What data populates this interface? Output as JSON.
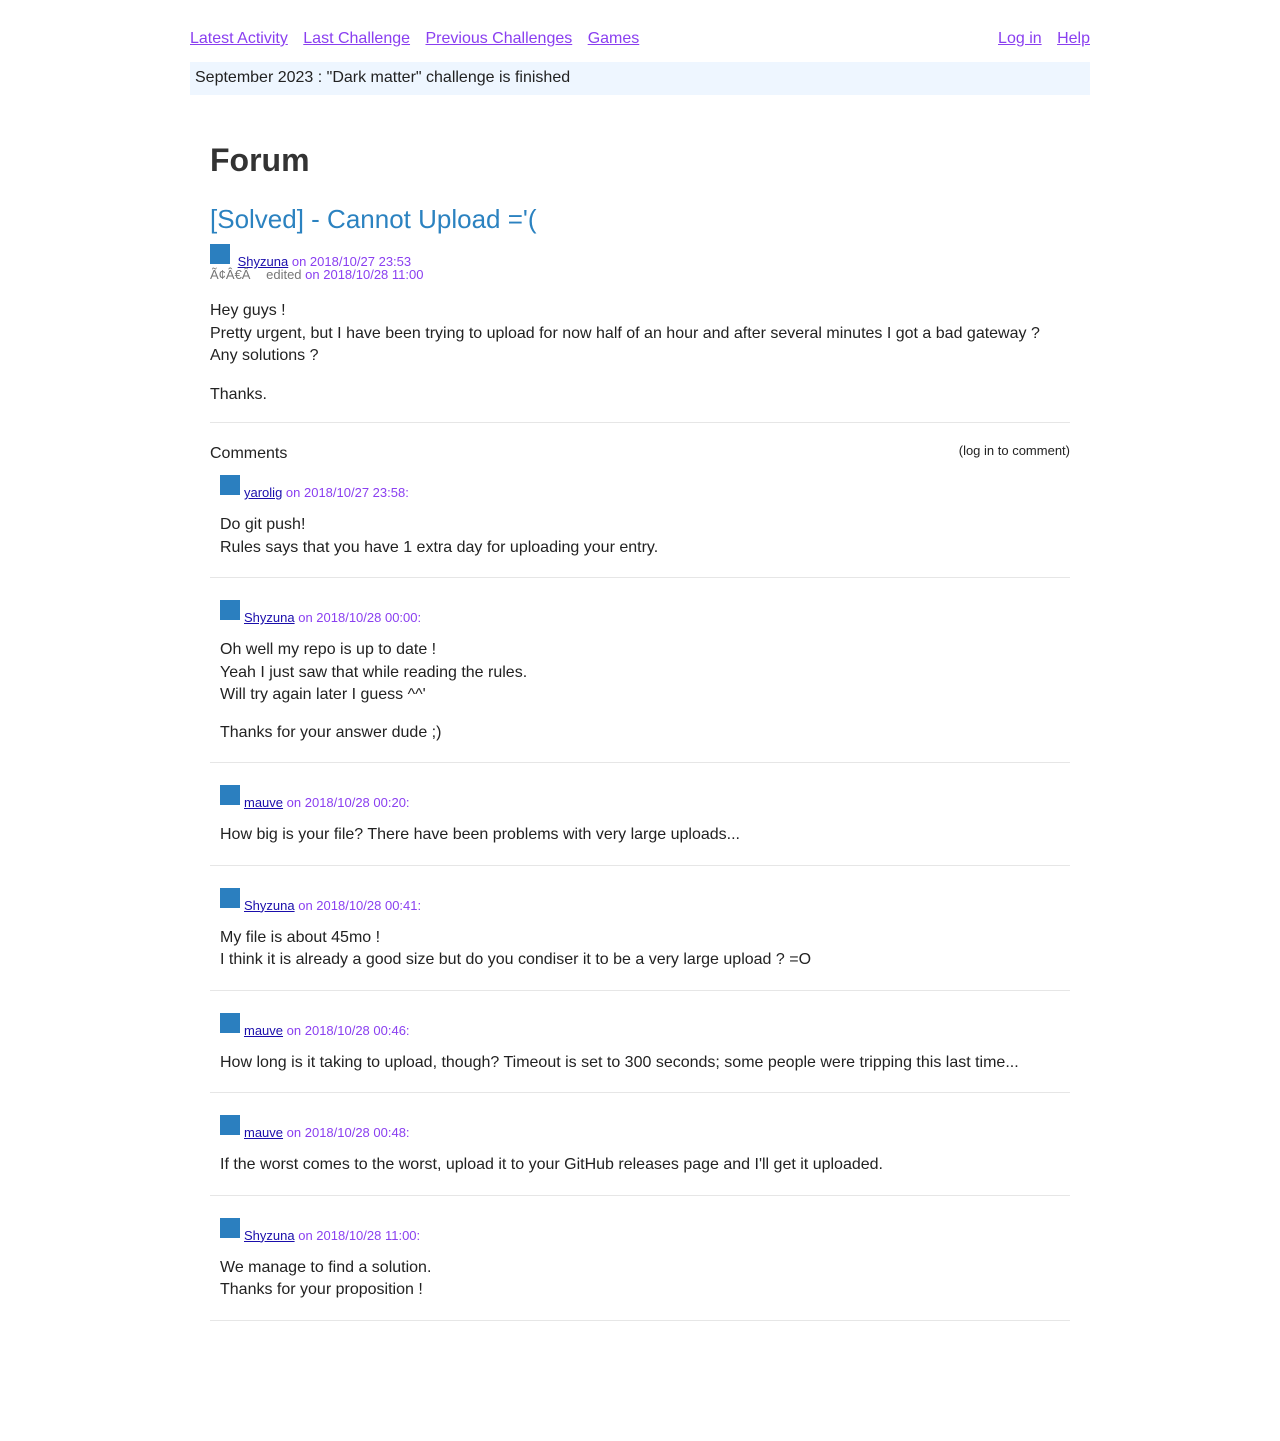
{
  "nav": {
    "left": [
      "Latest Activity",
      "Last Challenge",
      "Previous Challenges",
      "Games"
    ],
    "right": [
      "Log in",
      "Help"
    ]
  },
  "banner": "September 2023 : \"Dark matter\" challenge is finished",
  "page_title": "Forum",
  "topic": {
    "title": "[Solved] - Cannot Upload ='(",
    "author": "Shyzuna",
    "date": "on 2018/10/27 23:53",
    "garbled": "Ã¢Â€Â",
    "edited_label": "edited",
    "edited_date": "on 2018/10/28 11:00",
    "body": [
      "Hey guys !\nPretty urgent, but I have been trying to upload for now half of an hour and after several minutes I got a bad gateway ?\nAny solutions ?",
      "Thanks."
    ]
  },
  "comments_label": "Comments",
  "login_to_comment": "(log in to comment)",
  "comments": [
    {
      "author": "yarolig",
      "date": "on 2018/10/27 23:58:",
      "body": [
        "Do git push!\nRules says that you have 1 extra day for uploading your entry."
      ]
    },
    {
      "author": "Shyzuna",
      "date": "on 2018/10/28 00:00:",
      "body": [
        "Oh well my repo is up to date !\nYeah I just saw that while reading the rules.\nWill try again later I guess ^^'",
        "Thanks for your answer dude ;)"
      ]
    },
    {
      "author": "mauve",
      "date": "on 2018/10/28 00:20:",
      "body": [
        "How big is your file? There have been problems with very large uploads..."
      ]
    },
    {
      "author": "Shyzuna",
      "date": "on 2018/10/28 00:41:",
      "body": [
        "My file is about 45mo !\nI think it is already a good size but do you condiser it to be a very large upload ? =O"
      ]
    },
    {
      "author": "mauve",
      "date": "on 2018/10/28 00:46:",
      "body": [
        "How long is it taking to upload, though? Timeout is set to 300 seconds; some people were tripping this last time..."
      ]
    },
    {
      "author": "mauve",
      "date": "on 2018/10/28 00:48:",
      "body": [
        "If the worst comes to the worst, upload it to your GitHub releases page and I'll get it uploaded."
      ]
    },
    {
      "author": "Shyzuna",
      "date": "on 2018/10/28 11:00:",
      "body": [
        "We manage to find a solution.\nThanks for your proposition !"
      ]
    }
  ],
  "colors": {
    "link": "#8a3ff0",
    "user_link": "#1a0dab",
    "topic_title": "#2b82c0",
    "avatar": "#2b7fbf",
    "banner_bg": "#eef6ff"
  },
  "icons": {
    "avatar": "user-avatar-icon"
  }
}
